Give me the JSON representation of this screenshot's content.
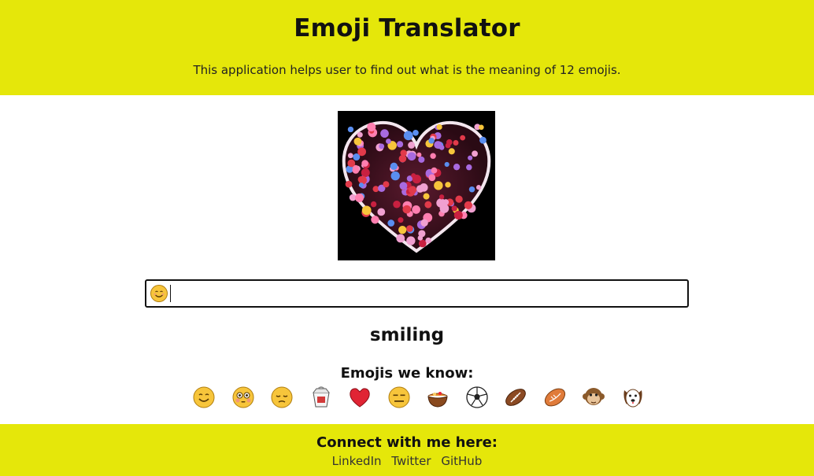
{
  "header": {
    "title": "Emoji Translator",
    "subtitle": "This application helps user to find out what is the meaning of 12 emojis."
  },
  "hero": {
    "icon": "heart-collage-image"
  },
  "input": {
    "value": "😊",
    "placeholder": ""
  },
  "result": {
    "meaning": "smiling"
  },
  "known": {
    "title": "Emojis we know:",
    "emojis": [
      "😊",
      "😳",
      "😔",
      "🥡",
      "❤️",
      "😑",
      "🍲",
      "⚽",
      "🏈",
      "🏉",
      "🐵",
      "🐶"
    ]
  },
  "footer": {
    "title": "Connect with me here:",
    "links": [
      "LinkedIn",
      "Twitter",
      "GitHub"
    ]
  },
  "colors": {
    "accent": "#e5e70a"
  }
}
